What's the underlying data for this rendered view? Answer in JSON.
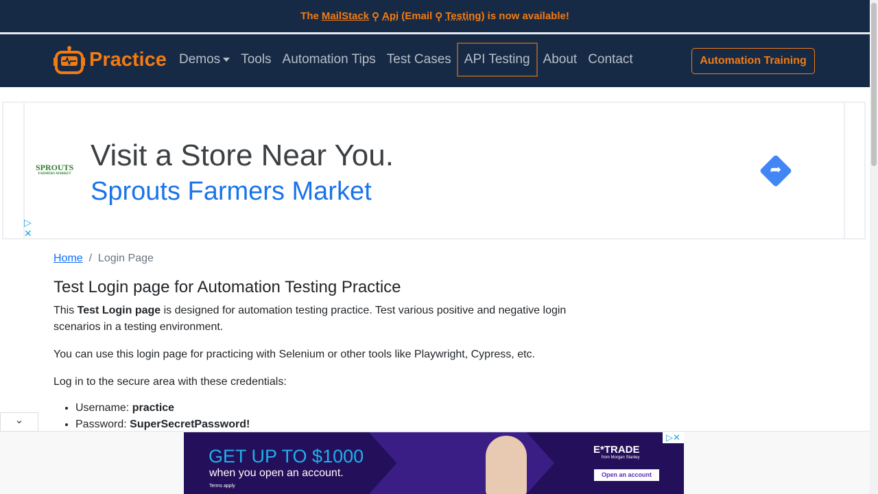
{
  "banner": {
    "prefix": "The",
    "link1": "MailStack",
    "link2": "Api",
    "mid": "(Email",
    "link3": "Testing",
    "suffix": ") is now available!"
  },
  "nav": {
    "brand": "Practice",
    "items": [
      "Demos",
      "Tools",
      "Automation Tips",
      "Test Cases",
      "API Testing",
      "About",
      "Contact"
    ],
    "cta": "Automation Training"
  },
  "ad_top": {
    "logo": "SPROUTS",
    "logo_sub": "FARMERS MARKET",
    "headline": "Visit a Store Near You.",
    "advertiser": "Sprouts Farmers Market"
  },
  "breadcrumb": {
    "home": "Home",
    "sep": "/",
    "current": "Login Page"
  },
  "main": {
    "title": "Test Login page for Automation Testing Practice",
    "p1_a": "This ",
    "p1_b": "Test Login page",
    "p1_c": " is designed for automation testing practice. Test various positive and negative login scenarios in a testing environment.",
    "p2": "You can use this login page for practicing with Selenium or other tools like Playwright, Cypress, etc.",
    "p3": "Log in to the secure area with these credentials:",
    "cred": [
      {
        "label": "Username: ",
        "value": "practice"
      },
      {
        "label": "Password: ",
        "value": "SuperSecretPassword!"
      }
    ]
  },
  "ad_bottom": {
    "headline": "GET UP TO $1000",
    "sub": "when you open an account.",
    "terms": "Terms apply",
    "brand": "E*TRADE",
    "brand_sub": "from Morgan Stanley",
    "button": "Open an account"
  }
}
